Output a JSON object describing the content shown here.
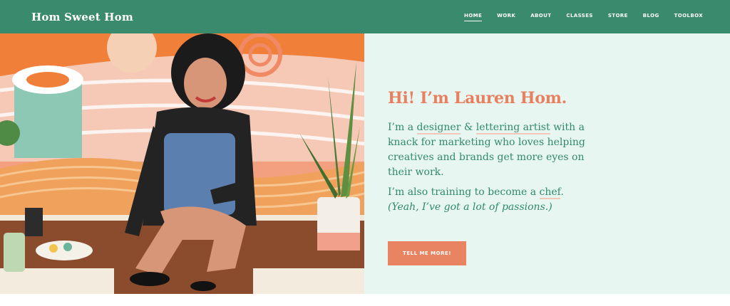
{
  "brand": {
    "logo_text": "Hom Sweet Hom"
  },
  "nav": {
    "items": [
      {
        "label": "HOME",
        "active": true
      },
      {
        "label": "WORK"
      },
      {
        "label": "ABOUT"
      },
      {
        "label": "CLASSES"
      },
      {
        "label": "STORE"
      },
      {
        "label": "BLOG"
      },
      {
        "label": "TOOLBOX"
      }
    ]
  },
  "hero": {
    "heading": "Hi! I’m Lauren Hom.",
    "para1": {
      "a": "I’m a ",
      "link1": "designer",
      "amp": " & ",
      "link2": "lettering artist",
      "b": " with a knack for marketing who loves helping creatives and brands get more eyes on their work."
    },
    "para2": {
      "a": "I’m also training to become a ",
      "link": "chef",
      "b": ".",
      "italic": "(Yeah, I’ve got a lot of passions.)"
    },
    "cta_label": "TELL ME MORE!"
  },
  "colors": {
    "nav_bg": "#3a8a6e",
    "panel_bg": "#e8f6f1",
    "accent": "#e87f5f",
    "text_green": "#2f8a6c"
  }
}
